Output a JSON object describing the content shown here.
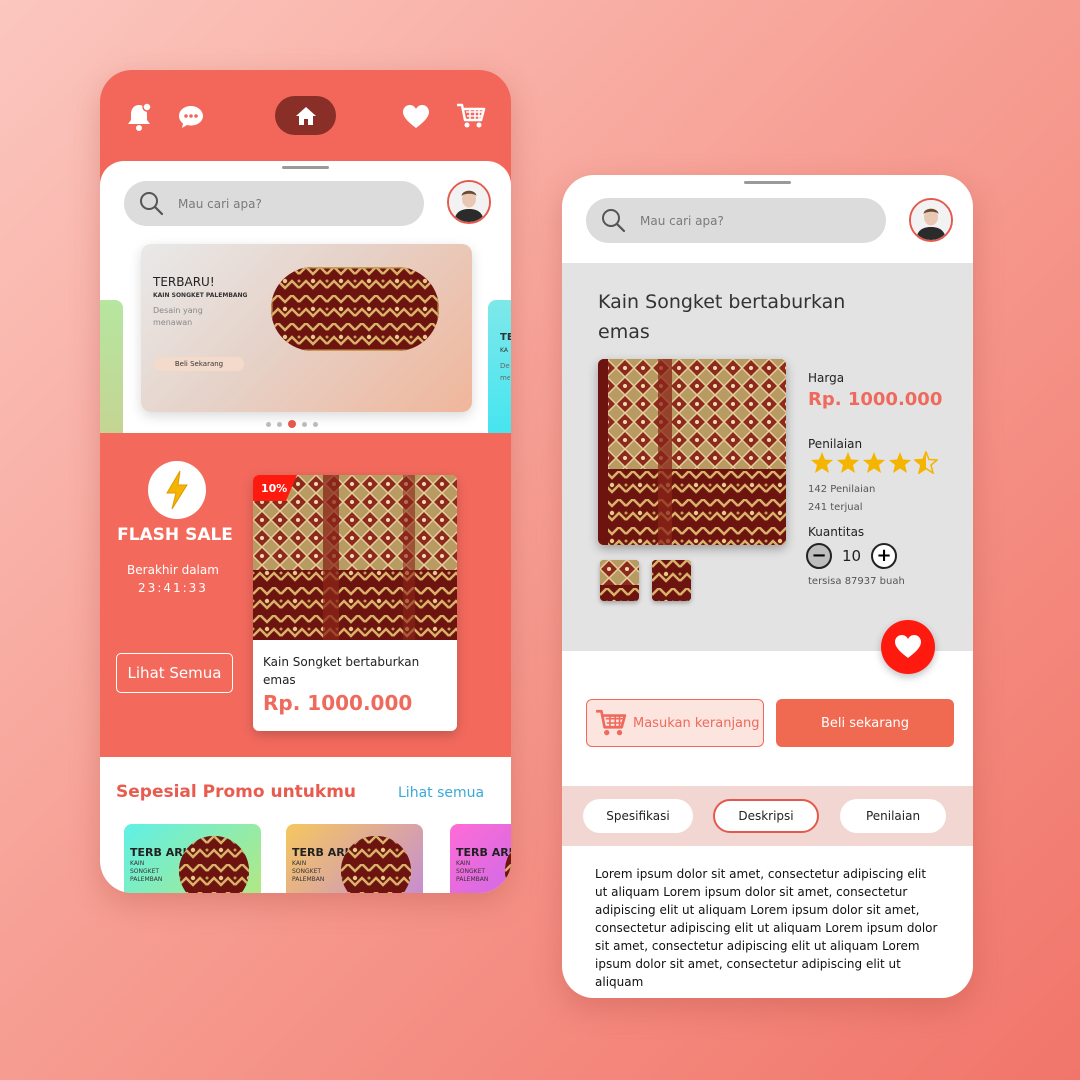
{
  "home": {
    "search_placeholder": "Mau cari apa?",
    "banner": {
      "title": "TERBARU!",
      "subtitle": "KAIN SONGKET PALEMBANG",
      "desc": "Desain yang menawan",
      "button": "Beli Sekarang",
      "next_peek_title": "TE",
      "next_peek_sub": "KA",
      "next_peek_desc": "De me"
    },
    "carousel_active_index": 2,
    "flash_sale": {
      "title": "FLASH SALE",
      "ends_label": "Berakhir dalam",
      "timer": "23:41:33",
      "see_all": "Lihat Semua",
      "product": {
        "discount": "10%",
        "name": "Kain Songket bertaburkan emas",
        "price": "Rp. 1000.000"
      }
    },
    "promo": {
      "title": "Sepesial Promo untukmu",
      "see_all": "Lihat semua",
      "cards": [
        {
          "t1": "TERB ARU!",
          "t2": "KAIN SONGKET PALEMBAN"
        },
        {
          "t1": "TERB ARU!",
          "t2": "KAIN SONGKET PALEMBAN"
        },
        {
          "t1": "TERB ARU!",
          "t2": "KAIN SONGKET PALEMBAN"
        }
      ]
    }
  },
  "detail": {
    "search_placeholder": "Mau cari apa?",
    "title": "Kain Songket bertaburkan emas",
    "price_label": "Harga",
    "price": "Rp. 1000.000",
    "rating_label": "Penilaian",
    "rating": 4.5,
    "reviews": "142 Penilaian",
    "sold": "241 terjual",
    "qty_label": "Kuantitas",
    "qty": "10",
    "stock": "tersisa 87937 buah",
    "btn_cart": "Masukan keranjang",
    "btn_buy": "Beli sekarang",
    "tabs": [
      "Spesifikasi",
      "Deskripsi",
      "Penilaian"
    ],
    "active_tab": "Deskripsi",
    "description": "Lorem ipsum dolor sit amet, consectetur adipiscing elit ut aliquam Lorem ipsum dolor sit amet, consectetur adipiscing elit ut aliquam Lorem ipsum dolor sit amet, consectetur adipiscing elit ut aliquam Lorem ipsum dolor sit amet, consectetur adipiscing elit ut aliquam Lorem ipsum dolor sit amet, consectetur adipiscing elit ut aliquam"
  },
  "icons": [
    "bell-icon",
    "chat-icon",
    "home-icon",
    "heart-icon",
    "cart-icon",
    "search-icon",
    "bolt-icon",
    "star-icon",
    "minus-icon",
    "plus-icon"
  ],
  "colors": {
    "accent": "#f3675b",
    "price": "#ef6a5c",
    "link": "#3aa9d8",
    "badge": "#ff1a0f",
    "star": "#f5b400"
  }
}
